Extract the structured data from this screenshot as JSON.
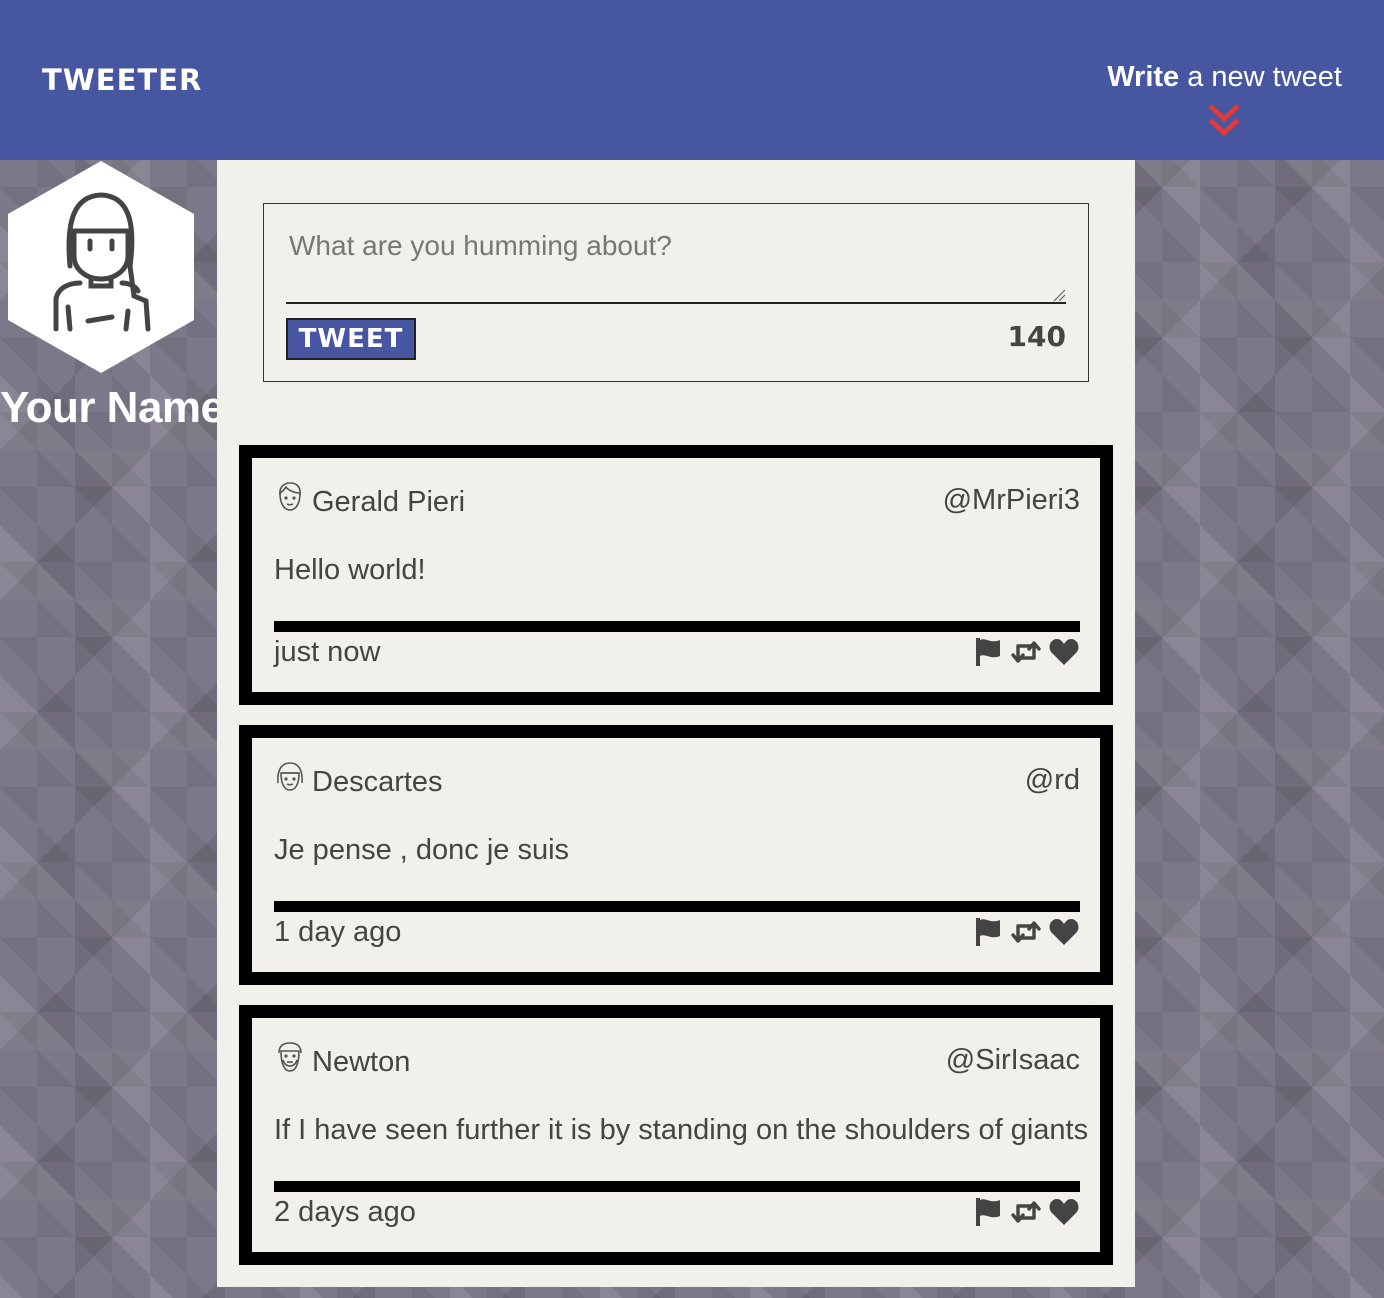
{
  "header": {
    "logo": "TWEETER",
    "compose_bold": "Write",
    "compose_rest": " a new tweet"
  },
  "profile": {
    "name": "Your Name"
  },
  "composer": {
    "placeholder": "What are you humming about?",
    "value": "",
    "submit_label": "TWEET",
    "char_count": "140"
  },
  "colors": {
    "header": "#4656a0",
    "accent": "#e03a3a",
    "panel": "#f2f0ea"
  },
  "tweets": [
    {
      "avatar_icon": "male-face-icon",
      "name": "Gerald Pieri",
      "handle": "@MrPieri3",
      "text": "Hello world!",
      "time": "just now"
    },
    {
      "avatar_icon": "female-face-icon",
      "name": "Descartes",
      "handle": "@rd",
      "text": "Je pense , donc je suis",
      "time": "1 day ago"
    },
    {
      "avatar_icon": "bearded-face-icon",
      "name": "Newton",
      "handle": "@SirIsaac",
      "text": "If I have seen further it is by standing on the shoulders of giants",
      "time": "2 days ago"
    }
  ]
}
